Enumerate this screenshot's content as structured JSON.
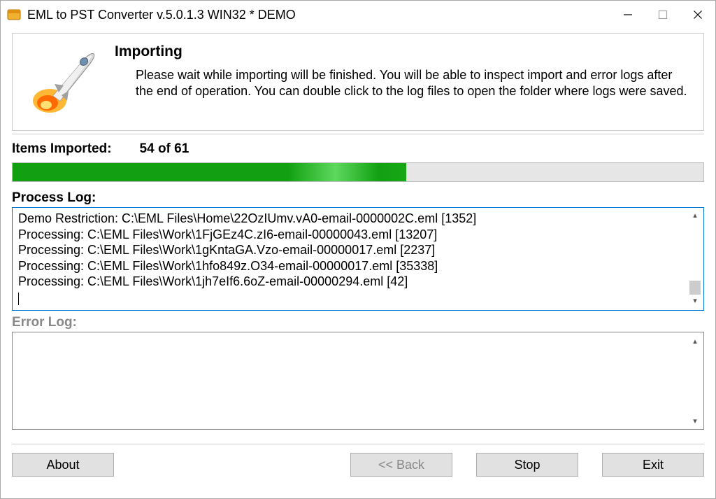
{
  "window": {
    "title": "EML to PST Converter v.5.0.1.3 WIN32 * DEMO"
  },
  "header": {
    "title": "Importing",
    "description": "Please wait while importing will be finished. You will be able to inspect import and error logs after the end of operation. You can double click to the log files to open the folder where logs were saved."
  },
  "progress": {
    "label": "Items Imported:",
    "count": "54 of 61",
    "percent": 57
  },
  "process_log": {
    "label": "Process Log:",
    "lines": [
      "Demo Restriction: C:\\EML Files\\Home\\22OzIUmv.vA0-email-0000002C.eml [1352]",
      "Processing: C:\\EML Files\\Work\\1FjGEz4C.zI6-email-00000043.eml [13207]",
      "Processing: C:\\EML Files\\Work\\1gKntaGA.Vzo-email-00000017.eml [2237]",
      "Processing: C:\\EML Files\\Work\\1hfo849z.O34-email-00000017.eml [35338]",
      "Processing: C:\\EML Files\\Work\\1jh7eIf6.6oZ-email-00000294.eml [42]"
    ]
  },
  "error_log": {
    "label": "Error Log:",
    "lines": []
  },
  "buttons": {
    "about": "About",
    "back": "<< Back",
    "stop": "Stop",
    "exit": "Exit"
  }
}
